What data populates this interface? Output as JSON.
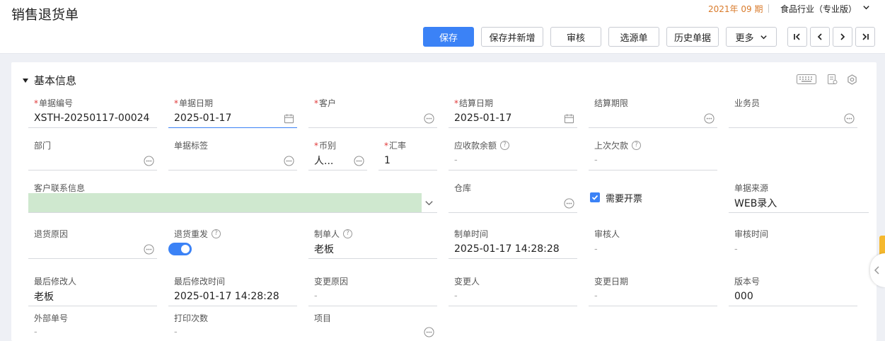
{
  "header": {
    "title": "销售退货单",
    "period": "2021年 09 期",
    "industry": "食品行业（专业版）"
  },
  "toolbar": {
    "save": "保存",
    "save_new": "保存并新增",
    "audit": "审核",
    "select_source": "选源单",
    "history": "历史单据",
    "more": "更多"
  },
  "section": {
    "title": "基本信息"
  },
  "fields": {
    "doc_no": {
      "label": "单据编号",
      "value": "XSTH-20250117-00024"
    },
    "doc_date": {
      "label": "单据日期",
      "value": "2025-01-17"
    },
    "customer": {
      "label": "客户",
      "value": ""
    },
    "settle_date": {
      "label": "结算日期",
      "value": "2025-01-17"
    },
    "settle_term": {
      "label": "结算期限",
      "value": ""
    },
    "salesman": {
      "label": "业务员",
      "value": ""
    },
    "dept": {
      "label": "部门",
      "value": ""
    },
    "doc_tag": {
      "label": "单据标签",
      "value": ""
    },
    "currency": {
      "label": "币别",
      "value": "人..."
    },
    "rate": {
      "label": "汇率",
      "value": "1"
    },
    "receivable": {
      "label": "应收款余额",
      "value": "-"
    },
    "last_debt": {
      "label": "上次欠款",
      "value": "-"
    },
    "contact": {
      "label": "客户联系信息",
      "value": ""
    },
    "warehouse": {
      "label": "仓库",
      "value": ""
    },
    "invoice": {
      "label": "需要开票",
      "checked": true
    },
    "source": {
      "label": "单据来源",
      "value": "WEB录入"
    },
    "return_reason": {
      "label": "退货原因",
      "value": ""
    },
    "reissue": {
      "label": "退货重发",
      "on": true
    },
    "creator": {
      "label": "制单人",
      "value": "老板"
    },
    "create_time": {
      "label": "制单时间",
      "value": "2025-01-17 14:28:28"
    },
    "auditor": {
      "label": "审核人",
      "value": "-"
    },
    "audit_time": {
      "label": "审核时间",
      "value": "-"
    },
    "last_modifier": {
      "label": "最后修改人",
      "value": "老板"
    },
    "last_modify_time": {
      "label": "最后修改时间",
      "value": "2025-01-17 14:28:28"
    },
    "change_reason": {
      "label": "变更原因",
      "value": "-"
    },
    "changer": {
      "label": "变更人",
      "value": "-"
    },
    "change_date": {
      "label": "变更日期",
      "value": "-"
    },
    "version": {
      "label": "版本号",
      "value": "000"
    },
    "external_no": {
      "label": "外部单号",
      "value": "-"
    },
    "print_count": {
      "label": "打印次数",
      "value": "-"
    },
    "project": {
      "label": "项目",
      "value": ""
    }
  },
  "colors": {
    "primary": "#3b82f6",
    "required": "#e03b3b",
    "period": "#d97b2b",
    "contact_bg": "#cfe8cf"
  }
}
